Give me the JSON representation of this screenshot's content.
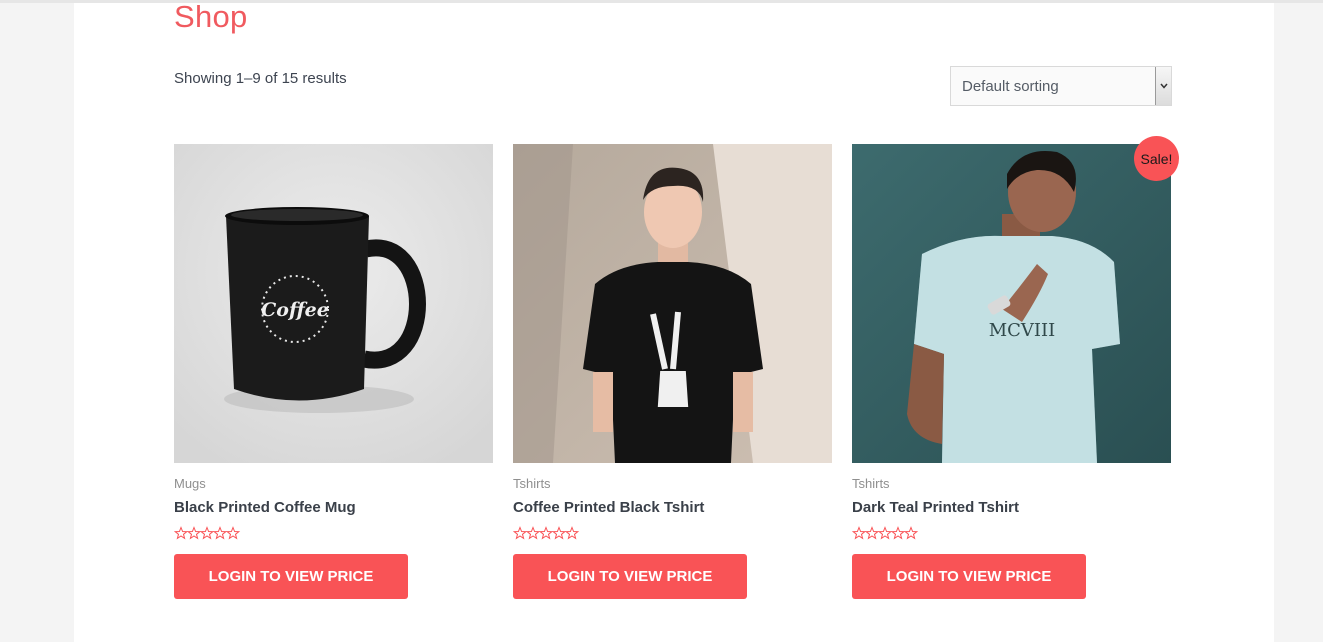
{
  "page": {
    "title": "Shop"
  },
  "result_count": "Showing 1–9 of 15 results",
  "sorting": {
    "selected": "Default sorting",
    "arrow_icon": "chevron-down-icon"
  },
  "colors": {
    "accent": "#f95356",
    "title": "#f05a5f"
  },
  "products": [
    {
      "category": "Mugs",
      "title": "Black Printed Coffee Mug",
      "button": "LOGIN TO VIEW PRICE",
      "rating": 0,
      "image": "coffee-mug-image",
      "mug_print": "Coffee"
    },
    {
      "category": "Tshirts",
      "title": "Coffee Printed Black Tshirt",
      "button": "LOGIN TO VIEW PRICE",
      "rating": 0,
      "image": "black-tshirt-model-image"
    },
    {
      "category": "Tshirts",
      "title": "Dark Teal Printed Tshirt",
      "button": "LOGIN TO VIEW PRICE",
      "rating": 0,
      "image": "teal-tshirt-model-image",
      "badge": "Sale!"
    }
  ]
}
